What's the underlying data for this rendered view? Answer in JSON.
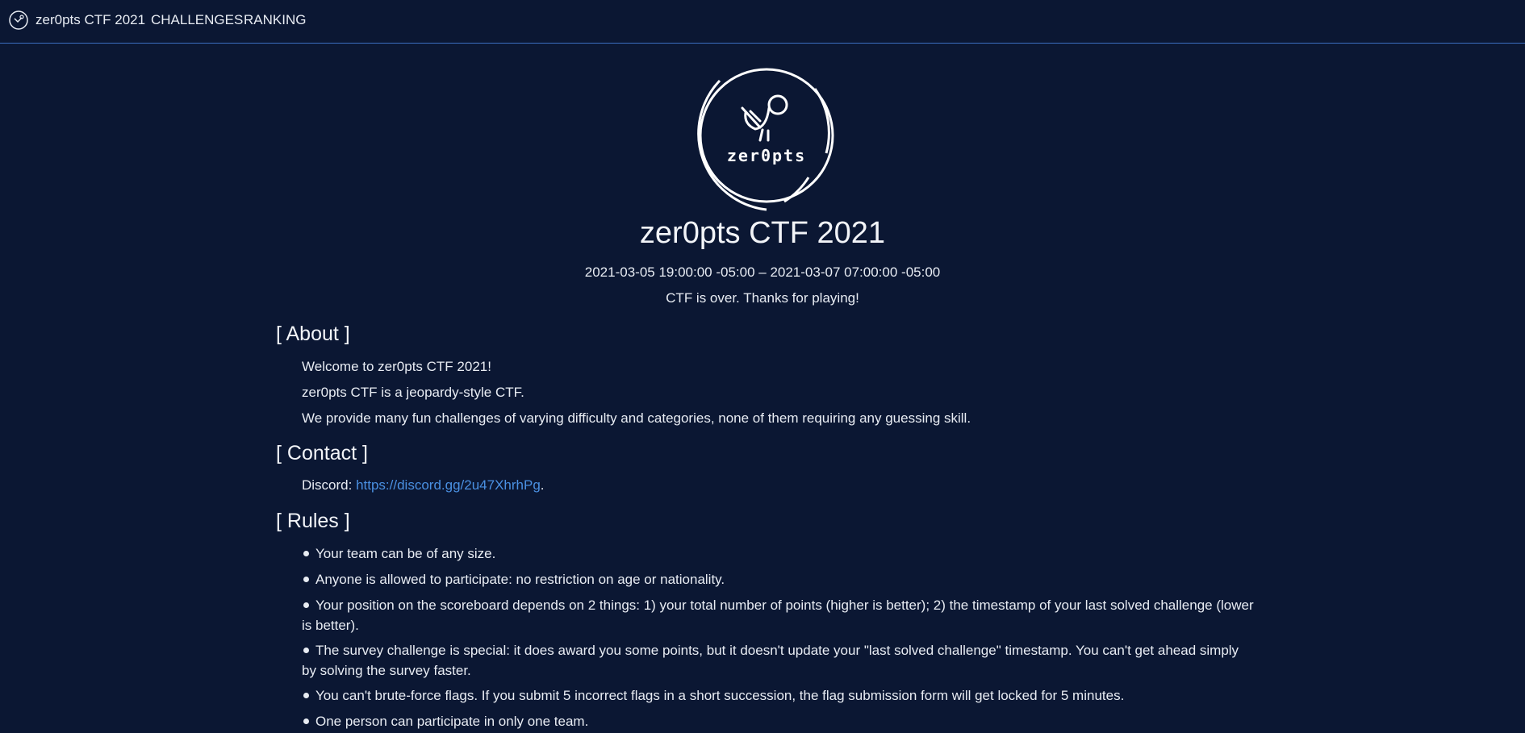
{
  "nav": {
    "brand": "zer0pts CTF 2021",
    "links": [
      "CHALLENGES",
      "RANKING"
    ]
  },
  "hero": {
    "logo_text": "zer0pts",
    "title": "zer0pts CTF 2021",
    "dates": "2021-03-05 19:00:00 -05:00 – 2021-03-07 07:00:00 -05:00",
    "status": "CTF is over. Thanks for playing!"
  },
  "about": {
    "title": "[ About ]",
    "lines": [
      "Welcome to zer0pts CTF 2021!",
      "zer0pts CTF is a jeopardy-style CTF.",
      "We provide many fun challenges of varying difficulty and categories, none of them requiring any guessing skill."
    ]
  },
  "contact": {
    "title": "[ Contact ]",
    "label": "Discord: ",
    "link": "https://discord.gg/2u47XhrhPg",
    "suffix": "."
  },
  "rules": {
    "title": "[ Rules ]",
    "items": [
      "Your team can be of any size.",
      "Anyone is allowed to participate: no restriction on age or nationality.",
      "Your position on the scoreboard depends on 2 things: 1) your total number of points (higher is better); 2) the timestamp of your last solved challenge (lower is better).",
      "The survey challenge is special: it does award you some points, but it doesn't update your \"last solved challenge\" timestamp. You can't get ahead simply by solving the survey faster.",
      "You can't brute-force flags. If you submit 5 incorrect flags in a short succession, the flag submission form will get locked for 5 minutes.",
      "One person can participate in only one team."
    ]
  },
  "colors": {
    "background": "#0b1733",
    "accent": "#3b6fc1",
    "link": "#4a90e2"
  }
}
